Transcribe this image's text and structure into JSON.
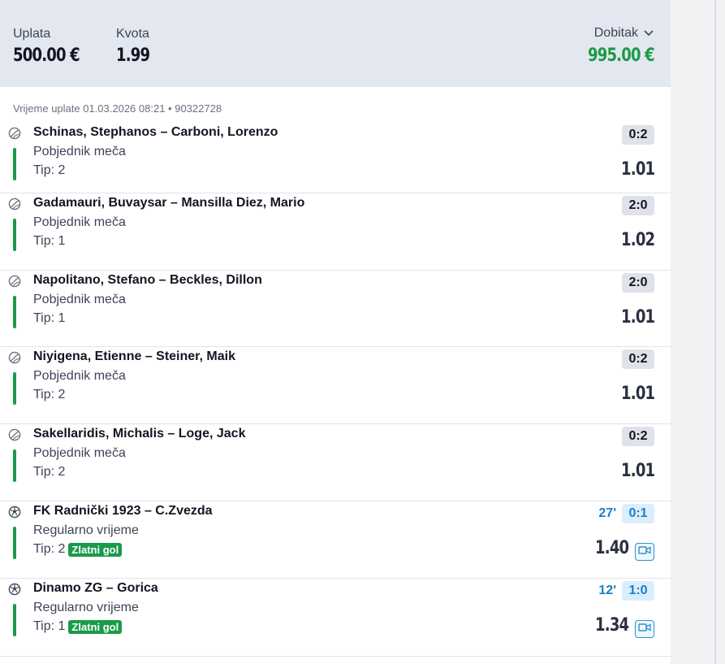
{
  "summary": {
    "stake_label": "Uplata",
    "stake_value": "500.00 €",
    "odds_label": "Kvota",
    "odds_value": "1.99",
    "win_label": "Dobitak",
    "win_value": "995.00 €"
  },
  "meta": "Vrijeme uplate 01.03.2026 08:21 • 90322728",
  "colors": {
    "win_green": "#1a9a4a",
    "live_blue": "#1c7fc4",
    "header_bg": "#e3e8f0"
  },
  "bets": [
    {
      "sport_icon": "tennis-icon",
      "match": "Schinas, Stephanos – Carboni, Lorenzo",
      "market": "Pobjednik meča",
      "tip": "Tip: 2",
      "score": "0:2",
      "odd": "1.01"
    },
    {
      "sport_icon": "tennis-icon",
      "match": "Gadamauri, Buvaysar – Mansilla Diez, Mario",
      "market": "Pobjednik meča",
      "tip": "Tip: 1",
      "score": "2:0",
      "odd": "1.02"
    },
    {
      "sport_icon": "tennis-icon",
      "match": "Napolitano, Stefano – Beckles, Dillon",
      "market": "Pobjednik meča",
      "tip": "Tip: 1",
      "score": "2:0",
      "odd": "1.01"
    },
    {
      "sport_icon": "tennis-icon",
      "match": "Niyigena, Etienne – Steiner, Maik",
      "market": "Pobjednik meča",
      "tip": "Tip: 2",
      "score": "0:2",
      "odd": "1.01"
    },
    {
      "sport_icon": "tennis-icon",
      "match": "Sakellaridis, Michalis – Loge, Jack",
      "market": "Pobjednik meča",
      "tip": "Tip: 2",
      "score": "0:2",
      "odd": "1.01"
    },
    {
      "sport_icon": "football-icon",
      "match": "FK Radnički 1923 – C.Zvezda",
      "market": "Regularno vrijeme",
      "tip": "Tip: 2",
      "tag": "Zlatni gol",
      "minute": "27'",
      "score": "0:1",
      "odd": "1.40",
      "video": true
    },
    {
      "sport_icon": "football-icon",
      "match": "Dinamo ZG – Gorica",
      "market": "Regularno vrijeme",
      "tip": "Tip: 1",
      "tag": "Zlatni gol",
      "minute": "12'",
      "score": "1:0",
      "odd": "1.34",
      "video": true
    }
  ]
}
